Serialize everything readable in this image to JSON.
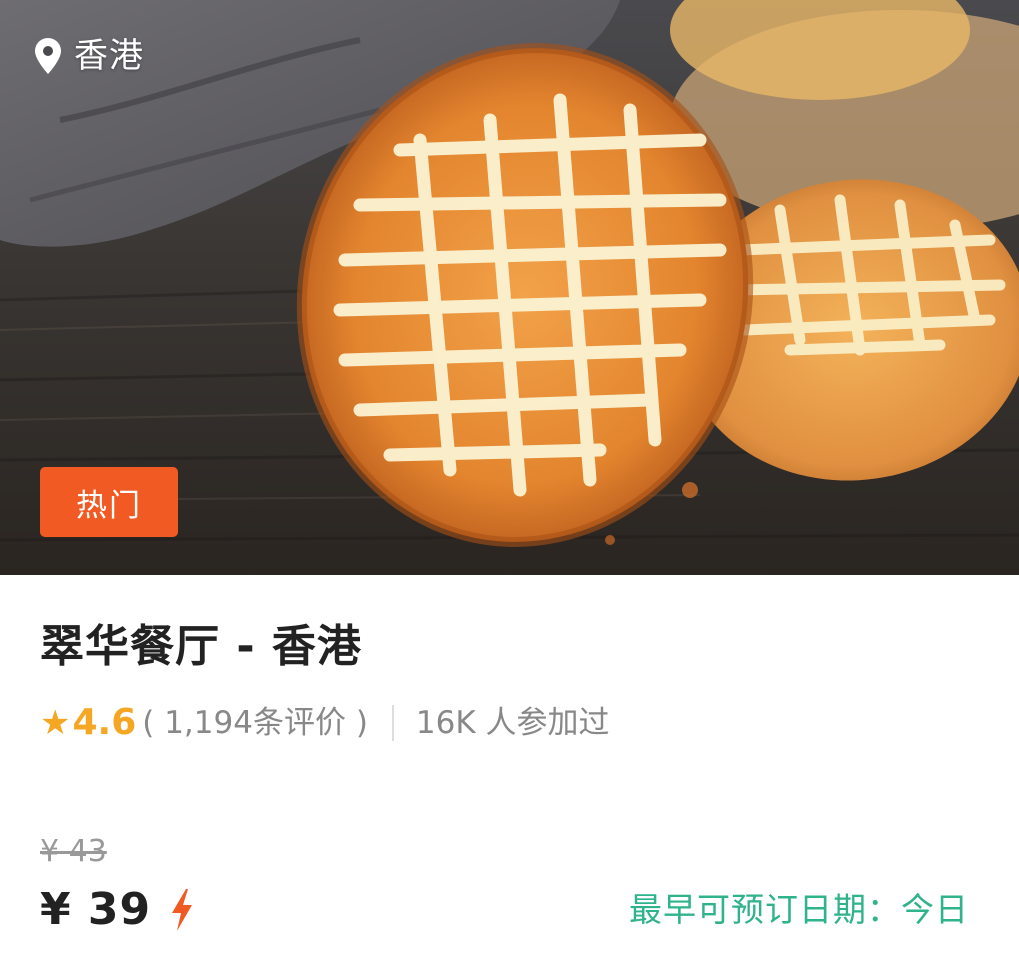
{
  "location": {
    "icon": "location-pin-icon",
    "label": "香港"
  },
  "badge": {
    "label": "热门",
    "color": "#f15a22"
  },
  "title": "翠华餐厅 - 香港",
  "rating": {
    "star_icon": "star-icon",
    "star_glyph": "★",
    "value": "4.6",
    "reviews": "( 1,194条评价 )",
    "color": "#f5a623"
  },
  "participants": "16K 人参加过",
  "price": {
    "original": "¥ 43",
    "current": "¥ 39",
    "instant_icon": "lightning-icon",
    "accent": "#f15a22"
  },
  "booking": "最早可预订日期：今日",
  "colors": {
    "booking_green": "#2fb38b",
    "title": "#222222",
    "secondary": "#888888"
  }
}
